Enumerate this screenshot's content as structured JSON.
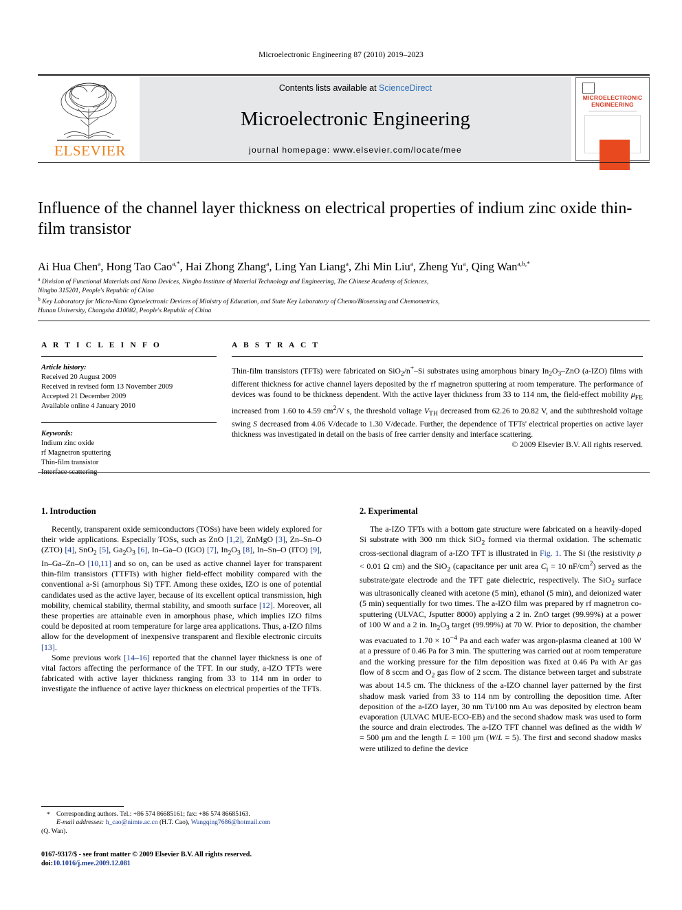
{
  "running_head": "Microelectronic Engineering 87 (2010) 2019–2023",
  "banner": {
    "publisher": "ELSEVIER",
    "contents_prefix": "Contents lists available at ",
    "contents_link": "ScienceDirect",
    "journal_name": "Microelectronic Engineering",
    "homepage": "journal homepage: www.elsevier.com/locate/mee",
    "cover_title_line1": "MICROELECTRONIC",
    "cover_title_line2": "ENGINEERING"
  },
  "article": {
    "title": "Influence of the channel layer thickness on electrical properties of indium zinc oxide thin-film transistor",
    "affiliation_a_line1": "Division of Functional Materials and Nano Devices, Ningbo Institute of Material Technology and Engineering, The Chinese Academy of Sciences,",
    "affiliation_a_line2": "Ningbo 315201, People's Republic of China",
    "affiliation_b_line1": "Key Laboratory for Micro-Nano Optoelectronic Devices of Ministry of Education, and State Key Laboratory of Chemo/Biosensing and Chemometrics,",
    "affiliation_b_line2": "Hunan University, Changsha 410082, People's Republic of China"
  },
  "authors": [
    {
      "name": "Ai Hua Chen",
      "sup": "a"
    },
    {
      "name": "Hong Tao Cao",
      "sup": "a,*"
    },
    {
      "name": "Hai Zhong Zhang",
      "sup": "a"
    },
    {
      "name": "Ling Yan Liang",
      "sup": "a"
    },
    {
      "name": "Zhi Min Liu",
      "sup": "a"
    },
    {
      "name": "Zheng Yu",
      "sup": "a"
    },
    {
      "name": "Qing Wan",
      "sup": "a,b,*"
    }
  ],
  "article_info": {
    "heading": "A R T I C L E   I N F O",
    "history_label": "Article history:",
    "history": [
      "Received 20 August 2009",
      "Received in revised form 13 November 2009",
      "Accepted 21 December 2009",
      "Available online 4 January 2010"
    ],
    "keywords_label": "Keywords:",
    "keywords": [
      "Indium zinc oxide",
      "rf Magnetron sputtering",
      "Thin-film transistor",
      "Interface scattering"
    ]
  },
  "abstract": {
    "heading": "A B S T R A C T",
    "copyright": "© 2009 Elsevier B.V. All rights reserved."
  },
  "sections": {
    "intro_heading": "1. Introduction",
    "experimental_heading": "2. Experimental"
  },
  "footnote": {
    "corresponding": "Corresponding authors. Tel.: +86 574 86685161; fax: +86 574 86685163.",
    "email_label": "E-mail addresses:",
    "email1": "h_cao@nimte.ac.cn",
    "email1_who": "(H.T. Cao),",
    "email2": "Wangqing7686@hotmail.com",
    "email2_who": "(Q. Wan)."
  },
  "imprint": {
    "line1": "0167-9317/$ - see front matter © 2009 Elsevier B.V. All rights reserved.",
    "doi_label": "doi:",
    "doi": "10.1016/j.mee.2009.12.081"
  },
  "colors": {
    "link_blue": "#1a3a8f",
    "sciencedirect_blue": "#2a6ebb",
    "elsevier_orange": "#ef7f1a",
    "cover_red": "#d2361e",
    "banner_grey": "#e6e7e8"
  }
}
